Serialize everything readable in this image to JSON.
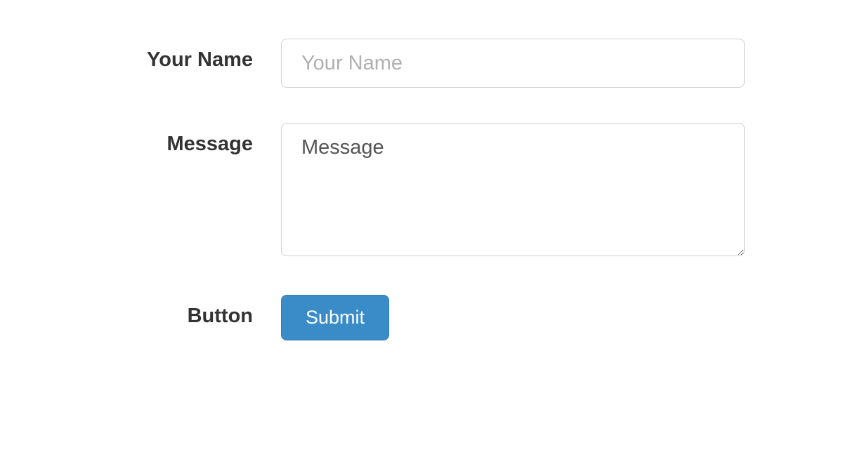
{
  "form": {
    "name": {
      "label": "Your Name",
      "placeholder": "Your Name",
      "value": ""
    },
    "message": {
      "label": "Message",
      "value": "Message"
    },
    "button": {
      "label": "Button",
      "submit_text": "Submit"
    }
  }
}
